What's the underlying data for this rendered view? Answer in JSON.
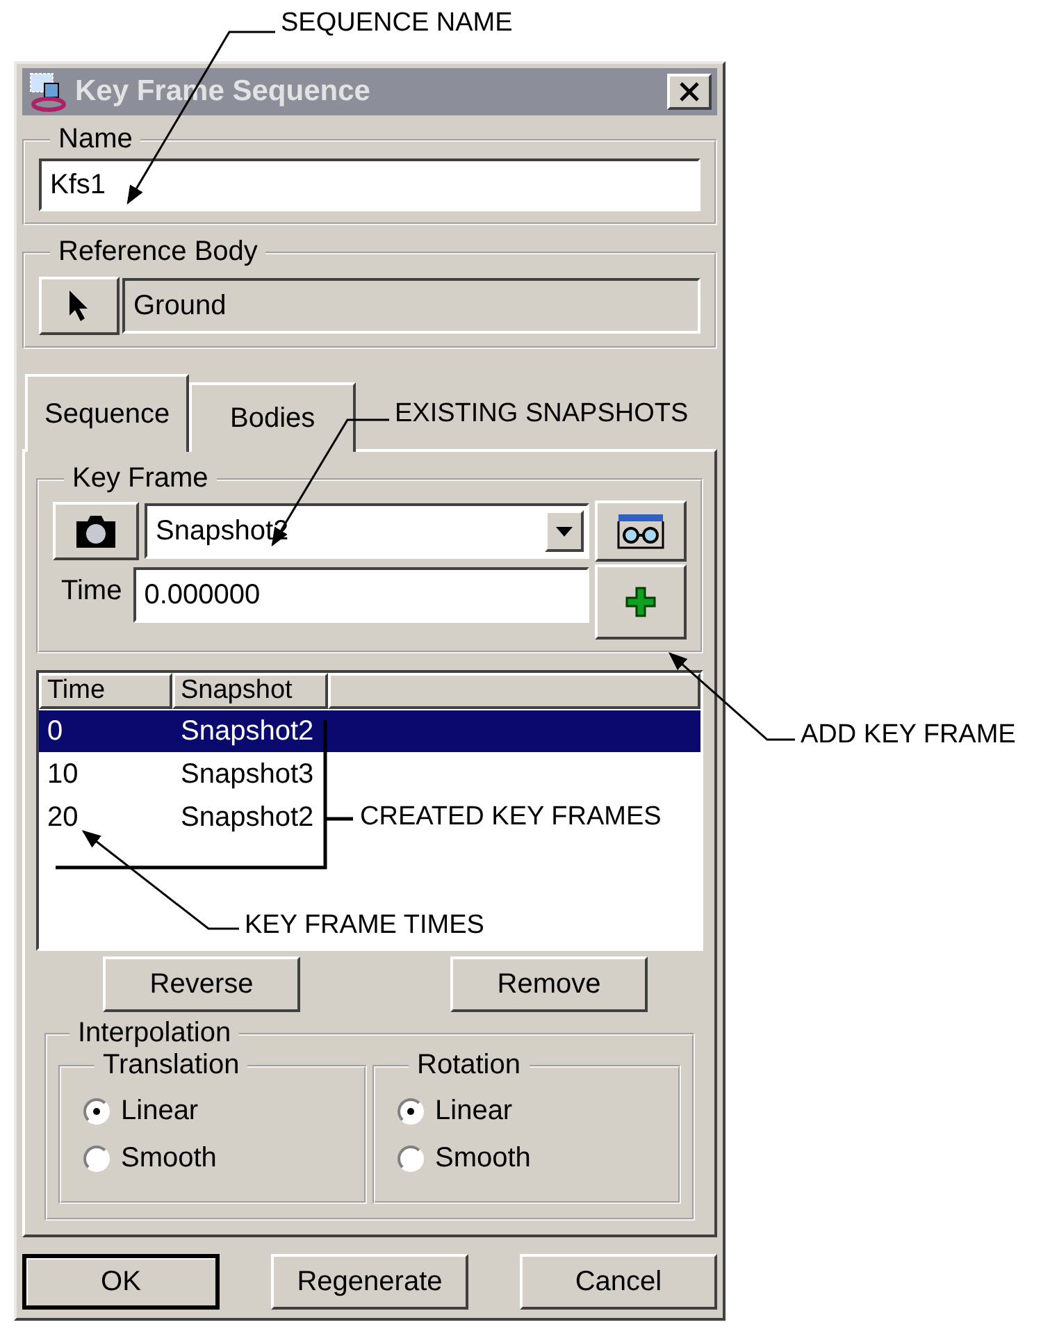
{
  "window": {
    "title": "Key Frame Sequence"
  },
  "name_group": {
    "label": "Name",
    "value": "Kfs1"
  },
  "reference_body": {
    "label": "Reference Body",
    "value": "Ground"
  },
  "tabs": [
    {
      "label": "Sequence",
      "selected": true
    },
    {
      "label": "Bodies",
      "selected": false
    }
  ],
  "key_frame": {
    "label": "Key Frame",
    "snapshot": "Snapshot2",
    "time_label": "Time",
    "time": "0.000000"
  },
  "table": {
    "columns": [
      "Time",
      "Snapshot"
    ],
    "rows": [
      {
        "time": "0",
        "snapshot": "Snapshot2",
        "selected": true
      },
      {
        "time": "10",
        "snapshot": "Snapshot3",
        "selected": false
      },
      {
        "time": "20",
        "snapshot": "Snapshot2",
        "selected": false
      }
    ]
  },
  "list_buttons": [
    "Reverse",
    "Remove"
  ],
  "interpolation": {
    "label": "Interpolation",
    "groups": [
      {
        "label": "Translation",
        "options": [
          {
            "label": "Linear",
            "selected": true
          },
          {
            "label": "Smooth",
            "selected": false
          }
        ]
      },
      {
        "label": "Rotation",
        "options": [
          {
            "label": "Linear",
            "selected": true
          },
          {
            "label": "Smooth",
            "selected": false
          }
        ]
      }
    ]
  },
  "buttons": [
    {
      "label": "OK",
      "default": true
    },
    {
      "label": "Regenerate",
      "default": false
    },
    {
      "label": "Cancel",
      "default": false
    }
  ],
  "annotations": [
    {
      "kind": "leader",
      "text": "SEQUENCE NAME"
    },
    {
      "kind": "leader",
      "text": "EXISTING SNAPSHOTS"
    },
    {
      "kind": "leader",
      "text": "ADD KEY FRAME"
    },
    {
      "kind": "bracket",
      "text": "CREATED KEY FRAMES"
    },
    {
      "kind": "leader",
      "text": "KEY FRAME TIMES"
    }
  ]
}
